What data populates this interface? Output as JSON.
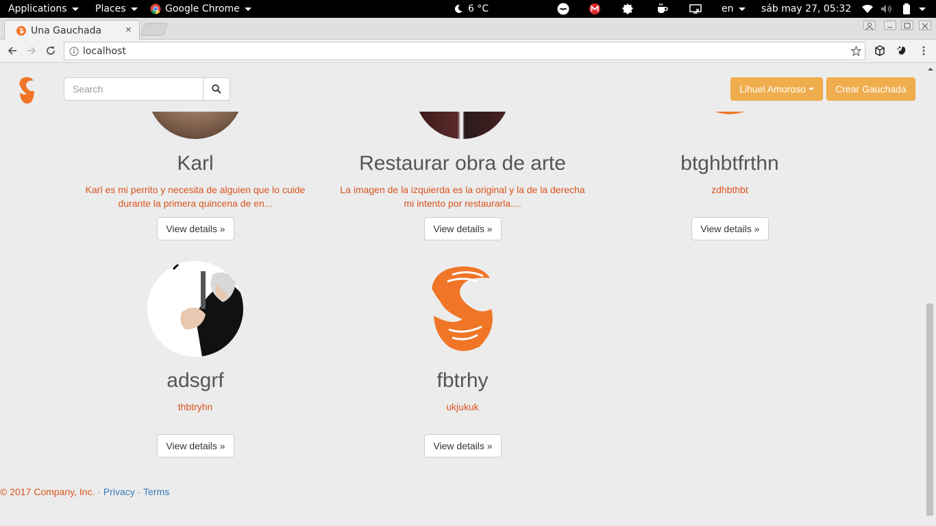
{
  "topbar": {
    "applications": "Applications",
    "places": "Places",
    "app_name": "Google Chrome",
    "weather": "6 °C",
    "lang": "en",
    "datetime": "sáb may 27, 05:32"
  },
  "tab": {
    "title": "Una Gauchada",
    "close": "×"
  },
  "omnibox": {
    "url": "localhost"
  },
  "navbar": {
    "search_placeholder": "Search",
    "user_menu": "Lihuel Amoroso",
    "create_button": "Crear Gauchada"
  },
  "cards": [
    {
      "title": "Karl",
      "desc": "Karl es mi perrito y necesita de alguien que lo cuide durante la primera quincena de en...",
      "button": "View details »"
    },
    {
      "title": "Restaurar obra de arte",
      "desc": "La imagen de la izquierda es la original y la de la derecha mi intento por restaurarla....",
      "button": "View details »"
    },
    {
      "title": "btghbtfrthn",
      "desc": "zdhbthbt",
      "button": "View details »"
    },
    {
      "title": "adsgrf",
      "desc": "thbtryhn",
      "button": "View details »"
    },
    {
      "title": "fbtrhy",
      "desc": "ukjukuk",
      "button": "View details »"
    }
  ],
  "footer": {
    "copyright": "© 2017 Company, Inc.",
    "sep": "·",
    "privacy": "Privacy",
    "terms": "Terms"
  },
  "colors": {
    "brand_orange": "#f07527",
    "accent_text": "#d9531e",
    "warning_button": "#f0ad4e",
    "link": "#337ab7"
  },
  "icons": [
    "moon-icon",
    "search-icon",
    "star-icon",
    "wifi-icon",
    "volume-icon",
    "battery-icon",
    "reload-icon",
    "back-icon",
    "forward-icon",
    "info-icon",
    "menu-icon"
  ]
}
